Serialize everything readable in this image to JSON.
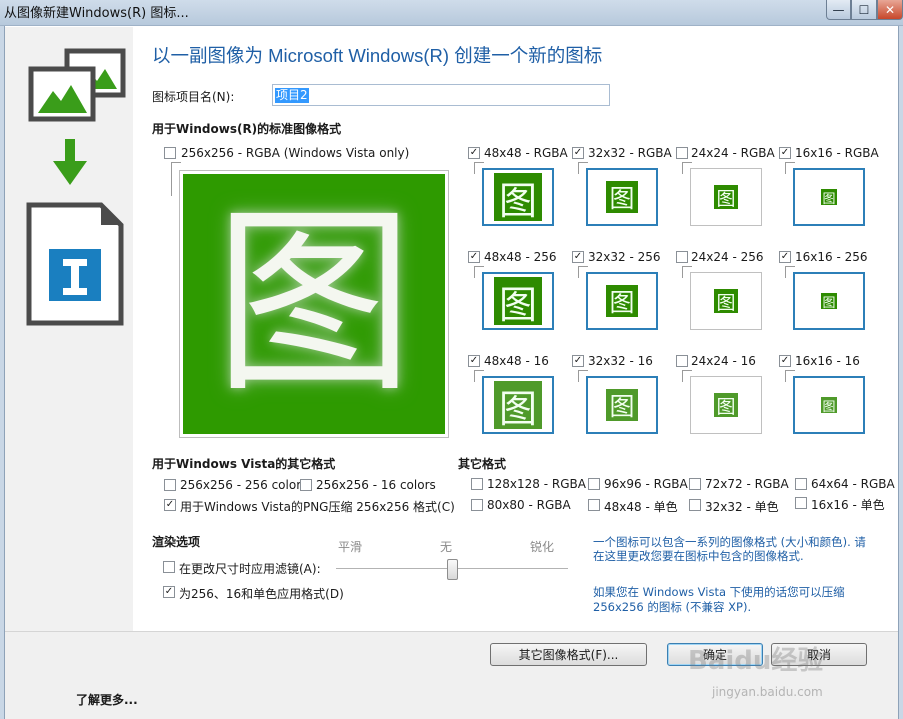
{
  "window": {
    "title": "从图像新建Windows(R) 图标...",
    "minimize_glyph": "—",
    "maximize_glyph": "☐",
    "close_glyph": "✕"
  },
  "heading": "以一副图像为 Microsoft Windows(R) 创建一个新的图标",
  "icon_name": {
    "label": "图标项目名(N):",
    "value": "项目2"
  },
  "standard_formats": {
    "title": "用于Windows(R)的标准图像格式",
    "large": {
      "label": "256x256 - RGBA (Windows Vista only)",
      "checked": false
    },
    "glyph": "图",
    "rows": [
      [
        {
          "label": "48x48 - RGBA",
          "checked": true
        },
        {
          "label": "32x32 - RGBA",
          "checked": true
        },
        {
          "label": "24x24 - RGBA",
          "checked": false
        },
        {
          "label": "16x16 - RGBA",
          "checked": true
        }
      ],
      [
        {
          "label": "48x48 - 256",
          "checked": true
        },
        {
          "label": "32x32 - 256",
          "checked": true
        },
        {
          "label": "24x24 - 256",
          "checked": false
        },
        {
          "label": "16x16 - 256",
          "checked": true
        }
      ],
      [
        {
          "label": "48x48 - 16",
          "checked": true
        },
        {
          "label": "32x32 - 16",
          "checked": true
        },
        {
          "label": "24x24 - 16",
          "checked": false
        },
        {
          "label": "16x16 - 16",
          "checked": true
        }
      ]
    ]
  },
  "vista_formats": {
    "title": "用于Windows Vista的其它格式",
    "items": [
      {
        "label": "256x256 - 256 colors",
        "checked": false
      },
      {
        "label": "256x256 - 16 colors",
        "checked": false
      },
      {
        "label": "用于Windows Vista的PNG压缩 256x256 格式(C)",
        "checked": true
      }
    ]
  },
  "other_formats": {
    "title": "其它格式",
    "items": [
      {
        "label": "128x128 - RGBA",
        "checked": false
      },
      {
        "label": "96x96 - RGBA",
        "checked": false
      },
      {
        "label": "72x72 - RGBA",
        "checked": false
      },
      {
        "label": "64x64 - RGBA",
        "checked": false
      },
      {
        "label": "80x80 - RGBA",
        "checked": false
      },
      {
        "label": "48x48 - 单色",
        "checked": false
      },
      {
        "label": "32x32 - 单色",
        "checked": false
      },
      {
        "label": "16x16 - 单色",
        "checked": false
      }
    ]
  },
  "render_options": {
    "title": "渲染选项",
    "filter_on_resize": {
      "label": "在更改尺寸时应用滤镜(A):",
      "checked": false
    },
    "apply_formats": {
      "label": "为256、16和单色应用格式(D)",
      "checked": true
    },
    "slider": {
      "left_label": "平滑",
      "mid_label": "无",
      "right_label": "锐化",
      "value_fraction": 0.5
    }
  },
  "info": {
    "line1": "一个图标可以包含一系列的图像格式 (大小和颜色). 请",
    "line2": "在这里更改您要在图标中包含的图像格式.",
    "line3": "如果您在 Windows Vista 下使用的话您可以压缩",
    "line4": "256x256 的图标 (不兼容 XP)."
  },
  "buttons": {
    "other_formats": "其它图像格式(F)...",
    "ok": "确定",
    "cancel": "取消"
  },
  "footer": {
    "learn_more": "了解更多..."
  },
  "watermark": {
    "main": "Baidu经验",
    "sub": "jingyan.baidu.com"
  },
  "colors": {
    "heading_blue": "#1f5fa6",
    "icon_green": "#2e9a00",
    "selected_border": "#2c7fb8",
    "sidebar_grey": "#4b4b4b",
    "doc_blue": "#1a7fc0"
  }
}
